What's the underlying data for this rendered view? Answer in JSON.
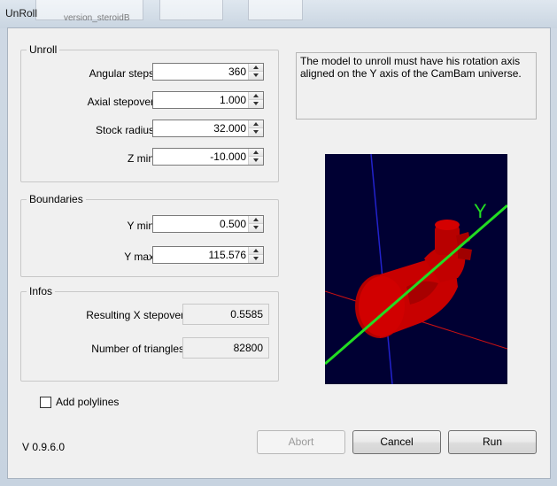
{
  "window": {
    "title": "UnRoll",
    "background_tab_text": "version_steroidB"
  },
  "unroll_group": {
    "title": "Unroll",
    "fields": [
      {
        "label": "Angular steps",
        "value": "360"
      },
      {
        "label": "Axial stepover",
        "value": "1.000"
      },
      {
        "label": "Stock radius",
        "value": "32.000"
      },
      {
        "label": "Z min",
        "value": "-10.000"
      }
    ]
  },
  "boundaries_group": {
    "title": "Boundaries",
    "fields": [
      {
        "label": "Y min",
        "value": "0.500"
      },
      {
        "label": "Y max",
        "value": "115.576"
      }
    ]
  },
  "infos_group": {
    "title": "Infos",
    "fields": [
      {
        "label": "Resulting X stepover",
        "value": "0.5585"
      },
      {
        "label": "Number of triangles",
        "value": "82800"
      }
    ]
  },
  "info_message": "The model to unroll must have his rotation axis aligned on the Y axis of the CamBam universe.",
  "viewport": {
    "axis_label_y": "Y",
    "background_color": "#000033",
    "model_color": "#cc0000",
    "y_axis_color": "#22dd22",
    "x_axis_color": "#cc1111",
    "z_axis_color": "#2222cc"
  },
  "add_polylines": {
    "label": "Add polylines",
    "checked": false
  },
  "version": "V 0.9.6.0",
  "buttons": {
    "abort": "Abort",
    "cancel": "Cancel",
    "run": "Run"
  }
}
